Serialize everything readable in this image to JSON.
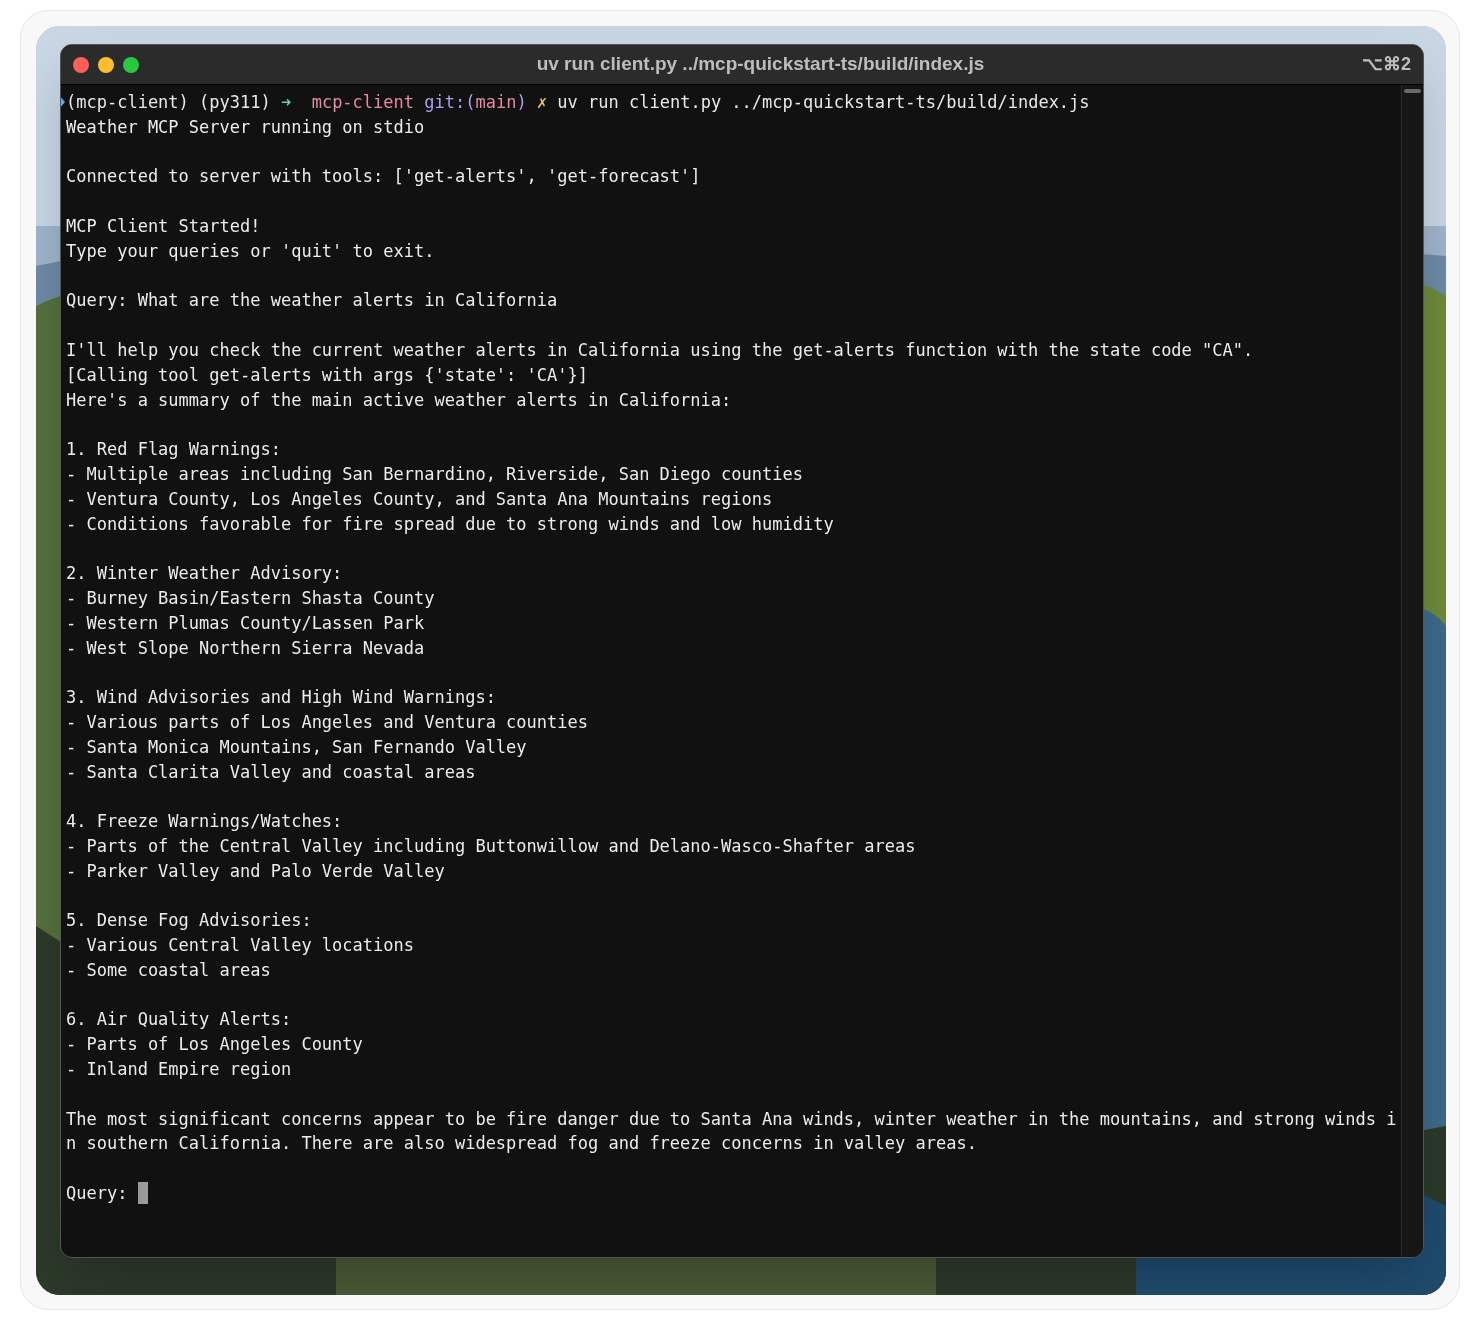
{
  "window": {
    "title": "uv run client.py ../mcp-quickstart-ts/build/index.js",
    "shortcut": "⌥⌘2"
  },
  "terminal": {
    "lines": [
      {
        "kind": "prompt",
        "segments": [
          {
            "text": "(mcp-client) (py311) ",
            "color": "#e8e8e8"
          },
          {
            "text": "➜",
            "color": "#5fd3a8"
          },
          {
            "text": "  mcp-client",
            "color": "#e88aa0"
          },
          {
            "text": " git:(",
            "color": "#a8a0e8"
          },
          {
            "text": "main",
            "color": "#e88aa0"
          },
          {
            "text": ")",
            "color": "#a8a0e8"
          },
          {
            "text": " ✗",
            "color": "#f0c070"
          },
          {
            "text": " uv run client.py ../mcp-quickstart-ts/build/index.js",
            "color": "#e8e8e8"
          }
        ]
      },
      {
        "kind": "output",
        "text": "Weather MCP Server running on stdio"
      },
      {
        "kind": "blank"
      },
      {
        "kind": "output",
        "text": "Connected to server with tools: ['get-alerts', 'get-forecast']"
      },
      {
        "kind": "blank"
      },
      {
        "kind": "output",
        "text": "MCP Client Started!"
      },
      {
        "kind": "output",
        "text": "Type your queries or 'quit' to exit."
      },
      {
        "kind": "blank"
      },
      {
        "kind": "output",
        "text": "Query: What are the weather alerts in California"
      },
      {
        "kind": "blank"
      },
      {
        "kind": "output",
        "text": "I'll help you check the current weather alerts in California using the get-alerts function with the state code \"CA\"."
      },
      {
        "kind": "output",
        "text": "[Calling tool get-alerts with args {'state': 'CA'}]"
      },
      {
        "kind": "output",
        "text": "Here's a summary of the main active weather alerts in California:"
      },
      {
        "kind": "blank"
      },
      {
        "kind": "output",
        "text": "1. Red Flag Warnings:"
      },
      {
        "kind": "output",
        "text": "- Multiple areas including San Bernardino, Riverside, San Diego counties"
      },
      {
        "kind": "output",
        "text": "- Ventura County, Los Angeles County, and Santa Ana Mountains regions"
      },
      {
        "kind": "output",
        "text": "- Conditions favorable for fire spread due to strong winds and low humidity"
      },
      {
        "kind": "blank"
      },
      {
        "kind": "output",
        "text": "2. Winter Weather Advisory:"
      },
      {
        "kind": "output",
        "text": "- Burney Basin/Eastern Shasta County"
      },
      {
        "kind": "output",
        "text": "- Western Plumas County/Lassen Park"
      },
      {
        "kind": "output",
        "text": "- West Slope Northern Sierra Nevada"
      },
      {
        "kind": "blank"
      },
      {
        "kind": "output",
        "text": "3. Wind Advisories and High Wind Warnings:"
      },
      {
        "kind": "output",
        "text": "- Various parts of Los Angeles and Ventura counties"
      },
      {
        "kind": "output",
        "text": "- Santa Monica Mountains, San Fernando Valley"
      },
      {
        "kind": "output",
        "text": "- Santa Clarita Valley and coastal areas"
      },
      {
        "kind": "blank"
      },
      {
        "kind": "output",
        "text": "4. Freeze Warnings/Watches:"
      },
      {
        "kind": "output",
        "text": "- Parts of the Central Valley including Buttonwillow and Delano-Wasco-Shafter areas"
      },
      {
        "kind": "output",
        "text": "- Parker Valley and Palo Verde Valley"
      },
      {
        "kind": "blank"
      },
      {
        "kind": "output",
        "text": "5. Dense Fog Advisories:"
      },
      {
        "kind": "output",
        "text": "- Various Central Valley locations"
      },
      {
        "kind": "output",
        "text": "- Some coastal areas"
      },
      {
        "kind": "blank"
      },
      {
        "kind": "output",
        "text": "6. Air Quality Alerts:"
      },
      {
        "kind": "output",
        "text": "- Parts of Los Angeles County"
      },
      {
        "kind": "output",
        "text": "- Inland Empire region"
      },
      {
        "kind": "blank"
      },
      {
        "kind": "output",
        "text": "The most significant concerns appear to be fire danger due to Santa Ana winds, winter weather in the mountains, and strong winds i"
      },
      {
        "kind": "output",
        "text": "n southern California. There are also widespread fog and freeze concerns in valley areas."
      },
      {
        "kind": "blank"
      },
      {
        "kind": "input",
        "text": "Query: "
      }
    ]
  }
}
